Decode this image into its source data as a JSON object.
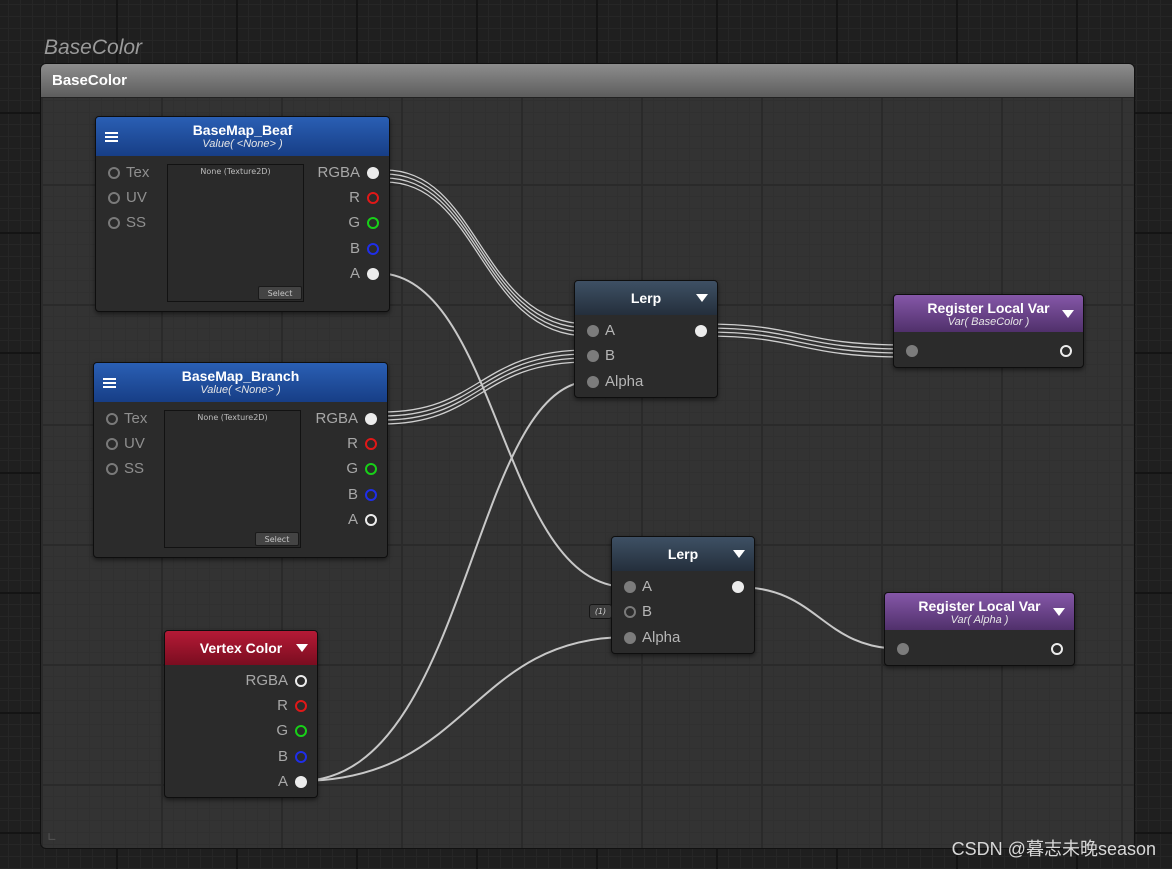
{
  "group": {
    "label": "BaseColor",
    "title": "BaseColor"
  },
  "nodes": {
    "basemap_beaf": {
      "title": "BaseMap_Beaf",
      "subtitle": "Value( <None> )",
      "inputs": [
        "Tex",
        "UV",
        "SS"
      ],
      "outputs": [
        "RGBA",
        "R",
        "G",
        "B",
        "A"
      ],
      "texture_label": "None (Texture2D)",
      "select_label": "Select"
    },
    "basemap_branch": {
      "title": "BaseMap_Branch",
      "subtitle": "Value( <None> )",
      "inputs": [
        "Tex",
        "UV",
        "SS"
      ],
      "outputs": [
        "RGBA",
        "R",
        "G",
        "B",
        "A"
      ],
      "texture_label": "None (Texture2D)",
      "select_label": "Select"
    },
    "vertex_color": {
      "title": "Vertex Color",
      "outputs": [
        "RGBA",
        "R",
        "G",
        "B",
        "A"
      ]
    },
    "lerp1": {
      "title": "Lerp",
      "inputs": [
        "A",
        "B",
        "Alpha"
      ]
    },
    "lerp2": {
      "title": "Lerp",
      "inputs": [
        "A",
        "B",
        "Alpha"
      ],
      "b_constant": "(1)"
    },
    "register1": {
      "title": "Register Local Var",
      "subtitle": "Var( BaseColor )"
    },
    "register2": {
      "title": "Register Local Var",
      "subtitle": "Var( Alpha )"
    }
  },
  "colors": {
    "port_r": "#e01818",
    "port_g": "#18d018",
    "port_b": "#1f2ee8",
    "header_texture": "#1f4c9e",
    "header_lerp": "#2f3c4c",
    "header_vertex": "#9a1229",
    "header_register": "#6b4590"
  },
  "watermark": "CSDN @暮志未晚season"
}
